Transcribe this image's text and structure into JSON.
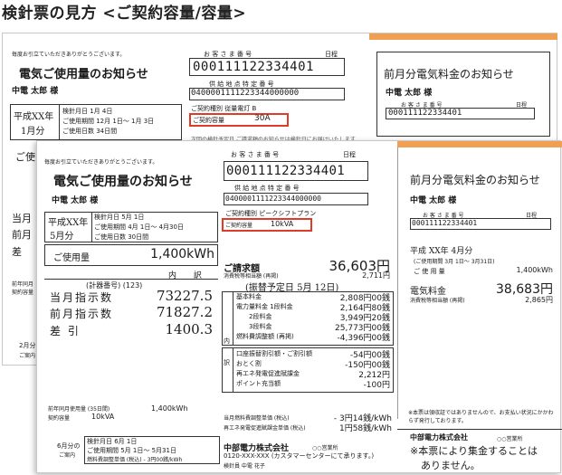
{
  "title": "検針票の見方 <ご契約容量/容量>",
  "back": {
    "greeting": "毎度お引立ていただきありがとうございます。",
    "notice_title": "電気ご使用量のお知らせ",
    "customer_name": "中電 太郎 様",
    "period": "平成XX年",
    "period_month": "1月分",
    "meter_reading_date": "検針月日 1月 4日",
    "usage_period": "ご使用期間 12月 1日～ 1月 3日",
    "usage_days": "ご使用日数 34日間",
    "customer_number_label": "お 客 さ ま 番 号",
    "customer_number": "000111122334401",
    "day_label": "日程",
    "supply_point_label": "供 給 地 点 特 定 番 号",
    "supply_point_number": "0400001111223344000000",
    "contract_type": "ご契約種別 従量電灯 B",
    "contract_capacity_label": "ご契約容量",
    "contract_capacity": "30A",
    "truncated_line": "次回の検針予定日 ご請求額のお知らせは検針日にお届けいたします",
    "left_usage": "ご使",
    "left_current": "当月",
    "left_previous": "前月",
    "left_diff": "差",
    "left_bottom1": "前年同月",
    "left_bottom2": "契約容量",
    "left_bottom3": "2月分",
    "left_bottom4": "ご案内",
    "right_title": "前月分電気料金のお知らせ",
    "right_name": "中電 太郎 様",
    "right_number_label": "お 客 さ ま 番 号",
    "right_number": "000111122334401",
    "right_day_label": "日程",
    "right_day": "01"
  },
  "front": {
    "greeting": "毎度お引立ていただきありがとうございます。",
    "notice_title": "電気ご使用量のお知らせ",
    "customer_name": "中電 太郎 様",
    "period": "平成XX年",
    "period_month": "5月分",
    "meter_reading_date": "検針月日 5月 1日",
    "usage_period": "ご使用期間 4月 1日～ 4月30日",
    "usage_days": "ご使用日数 30日間",
    "usage_label": "ご使用量",
    "usage_value": "1,400kWh",
    "breakdown_label": "内 訳",
    "meter_number": "(計器番号) (123)",
    "current_reading_label": "当月指示数",
    "current_reading": "73227.5",
    "previous_reading_label": "前月指示数",
    "previous_reading": "71827.2",
    "diff_label": "差 引",
    "diff_value": "1400.3",
    "last_year_label": "前年同月使用量 (35日間)",
    "last_year_value": "1,400kWh",
    "capacity_label": "契約容量",
    "capacity_value": "10kVA",
    "next_label": "6月分の",
    "next_label2": "ご案内",
    "next_reading": "検針月日 6月 1日",
    "next_period": "ご使用期間 5月 1日～ 5月31日",
    "next_fuel": "燃料費調整単価 (税込) - 3円00銭/kWh",
    "customer_number_label": "お 客 さ ま 番 号",
    "customer_number": "000111122334401",
    "day_label": "日程",
    "supply_point_label": "供 給 地 点 特 定 番 号",
    "supply_point_number": "0400001111223344000000",
    "contract_type": "ご契約種別 ピークシフトプラン",
    "contract_capacity_label": "ご契約容量",
    "contract_capacity": "10kVA",
    "bill_label": "ご請求額",
    "bill_value": "36,603円",
    "bill_tax_label": "消費税等相当額 (再掲)",
    "bill_tax": "2,711円",
    "transfer_label": "(振替予定日 5月 12日)",
    "charges": [
      {
        "label": "基本料金",
        "value": "2,808円00銭"
      },
      {
        "label": "電力量料金 1段料金",
        "value": "2,164円80銭"
      },
      {
        "label": "2段料金",
        "value": "3,949円20銭"
      },
      {
        "label": "3段料金",
        "value": "25,773円00銭"
      },
      {
        "label": "燃料費調整額 (再掲)",
        "value": "-4,396円00銭"
      }
    ],
    "discounts": [
      {
        "label": "口座振替割引額・ご割引額",
        "value": "-54円00銭"
      },
      {
        "label": "おとく割",
        "value": "-150円00銭"
      },
      {
        "label": "再エネ発電促進賦課金",
        "value": "2,212円"
      },
      {
        "label": "ポイント充当額",
        "value": "-100円"
      }
    ],
    "side_labels": [
      "内",
      "訳"
    ],
    "fuel_rate_label": "当月燃料費調整単価 (税込)",
    "fuel_rate_value": "- 3円14銭/kWh",
    "renew_rate_label": "再エネ発電促進賦課金単価 (税込)",
    "renew_rate_value": "1円58銭/kWh",
    "company": "中部電力株式会社",
    "company_office": "○○営業所",
    "phone": "0120-XXX-XXX (カスタマーセンターにて承ります。)",
    "staff": "検針員 中電 花子",
    "right_title": "前月分電気料金のお知らせ",
    "right_name": "中電 太郎 様",
    "right_number_label": "お 客 さ ま 番 号",
    "right_number": "000111122334401",
    "right_day_label": "日程",
    "right_day": "01",
    "right_period": "平成 XX年 4月分",
    "right_usage_period": "(ご使用期間 3月 1日～ 3月31日)",
    "right_usage_label": "ご 使 用 量",
    "right_usage_value": "1,400kWh",
    "right_fee_label": "電気料金",
    "right_fee_value": "38,683円",
    "right_tax_label": "消費税等相当額 (再掲)",
    "right_tax_value": "2,865円",
    "right_note": "※本票は領収証ではありませんので、お支払い状況にかかわらず発行しております。",
    "right_company": "中部電力株式会社",
    "right_office": "○○営業所",
    "right_notice1": "※本票により集金することは",
    "right_notice2": "ありません。"
  },
  "colors": {
    "highlight_red": "#e03a28",
    "accent_orange": "#f0a050"
  }
}
